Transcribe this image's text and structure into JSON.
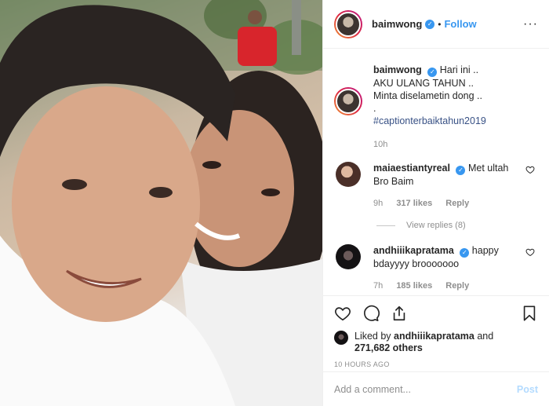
{
  "post": {
    "username": "baimwong",
    "follow_label": "Follow",
    "dot": "•",
    "more": "···"
  },
  "caption": {
    "username": "baimwong",
    "line1": "Hari ini ..",
    "line2": "AKU ULANG TAHUN ..",
    "line3": "Minta diselametin dong ..",
    "line4": ".",
    "hashtag": "#captionterbaiktahun2019",
    "time": "10h"
  },
  "comments": [
    {
      "username": "maiaestiantyreal",
      "text": "Met ultah Bro Baim",
      "time": "9h",
      "likes": "317 likes",
      "reply": "Reply",
      "view_replies": "View replies (8)"
    },
    {
      "username": "andhiiikapratama",
      "text": "happy bdayyyy brooooooo",
      "time": "7h",
      "likes": "185 likes",
      "reply": "Reply"
    }
  ],
  "likes": {
    "prefix": "Liked by",
    "user": "andhiiikapratama",
    "and": "and",
    "others": "271,682 others"
  },
  "date": "10 HOURS AGO",
  "composer": {
    "placeholder": "Add a comment...",
    "post_label": "Post"
  },
  "icons": {
    "like": "heart-icon",
    "comment": "comment-icon",
    "share": "share-icon",
    "save": "bookmark-icon"
  },
  "colors": {
    "accent": "#3897f0",
    "muted": "#8e8e8e",
    "post_disabled": "#b3dbff",
    "border": "#efefef"
  }
}
